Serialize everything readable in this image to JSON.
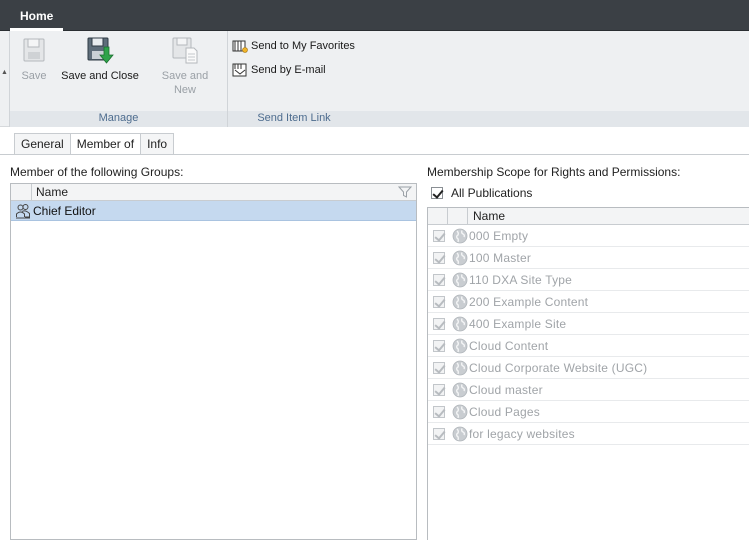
{
  "topbar": {
    "home_tab": "Home"
  },
  "ribbon": {
    "manage": {
      "label": "Manage",
      "save": "Save",
      "save_and_close": "Save and Close",
      "save_and_new_line1": "Save and",
      "save_and_new_line2": "New"
    },
    "send_item_link": {
      "label": "Send Item Link",
      "send_to_favorites": "Send to My Favorites",
      "send_by_email": "Send by E-mail"
    }
  },
  "tabs": [
    "General",
    "Member of",
    "Info"
  ],
  "active_tab": "Member of",
  "groups_section": {
    "caption": "Member of the following Groups:",
    "column_name": "Name",
    "rows": [
      {
        "name": "Chief Editor",
        "icon": "user-group-icon"
      }
    ]
  },
  "scope_section": {
    "caption": "Membership Scope for Rights and Permissions:",
    "all_publications_label": "All Publications",
    "all_publications_checked": true,
    "column_name": "Name",
    "publications": [
      {
        "name": "000 Empty",
        "checked": true
      },
      {
        "name": "100 Master",
        "checked": true
      },
      {
        "name": "110 DXA Site Type",
        "checked": true
      },
      {
        "name": "200 Example Content",
        "checked": true
      },
      {
        "name": "400 Example Site",
        "checked": true
      },
      {
        "name": "Cloud Content",
        "checked": true
      },
      {
        "name": "Cloud Corporate Website (UGC)",
        "checked": true
      },
      {
        "name": "Cloud master",
        "checked": true
      },
      {
        "name": "Cloud Pages",
        "checked": true
      },
      {
        "name": "for legacy websites",
        "checked": true
      }
    ]
  },
  "colors": {
    "topbar": "#3b4045",
    "ribbon": "#eef0f2",
    "selection": "#c5d9ef",
    "group_label": "#4d6c8e",
    "disabled_text": "#a0a4a8"
  }
}
